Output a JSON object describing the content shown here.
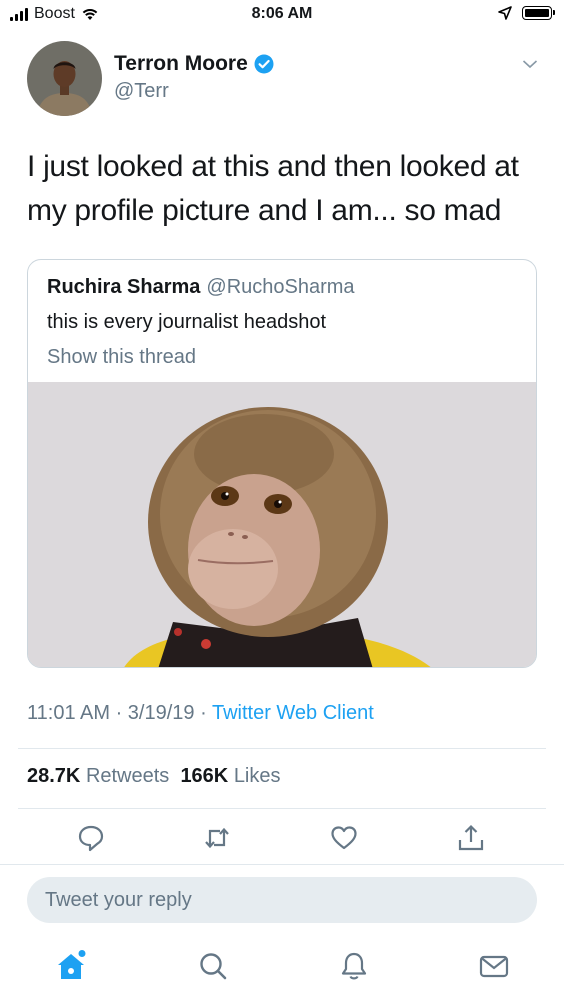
{
  "status_bar": {
    "carrier": "Boost",
    "time": "8:06 AM"
  },
  "tweet": {
    "author_name": "Terron Moore",
    "author_handle": "@Terr",
    "text": "I just looked at this and then looked at my profile picture and I am... so mad",
    "timestamp": "11:01 AM · 3/19/19 ·",
    "source": "Twitter Web Client",
    "retweets_count": "28.7K",
    "retweets_label": "Retweets",
    "likes_count": "166K",
    "likes_label": "Likes"
  },
  "quoted_tweet": {
    "author_name": "Ruchira Sharma",
    "author_handle": "@RuchoSharma",
    "text": "this is every journalist headshot",
    "thread_link": "Show this thread"
  },
  "reply": {
    "placeholder": "Tweet your reply"
  },
  "colors": {
    "accent": "#1da1f2",
    "secondary_text": "#657786",
    "divider": "#e1e8ed"
  },
  "icons": {
    "actions": [
      "reply-icon",
      "retweet-icon",
      "like-icon",
      "share-icon"
    ],
    "tabs": [
      "home-icon",
      "search-icon",
      "notifications-icon",
      "messages-icon"
    ]
  }
}
